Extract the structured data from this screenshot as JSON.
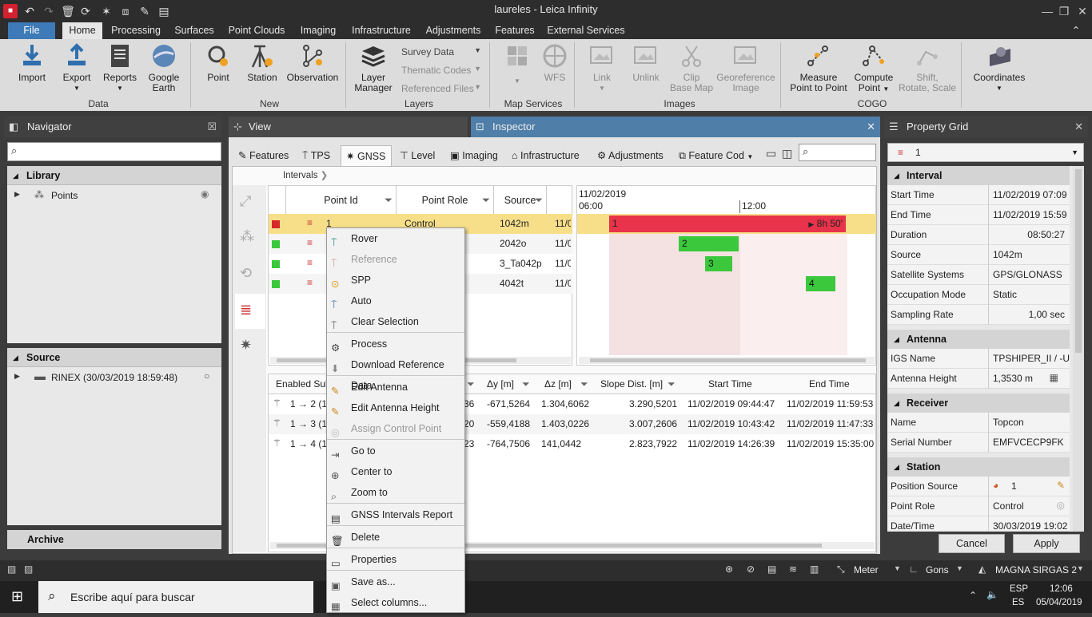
{
  "window": {
    "title": "laureles - Leica Infinity"
  },
  "menu": {
    "file": "File",
    "tabs": [
      "Home",
      "Processing",
      "Surfaces",
      "Point Clouds",
      "Imaging",
      "Infrastructure",
      "Adjustments",
      "Features",
      "External Services"
    ]
  },
  "ribbon": {
    "data": {
      "label": "Data",
      "import": "Import",
      "export": "Export",
      "reports": "Reports",
      "google_earth_1": "Google",
      "google_earth_2": "Earth"
    },
    "new": {
      "label": "New",
      "point": "Point",
      "station": "Station",
      "observation": "Observation"
    },
    "layers": {
      "label": "Layers",
      "layer_manager_1": "Layer",
      "layer_manager_2": "Manager",
      "survey_data": "Survey Data",
      "thematic_codes": "Thematic Codes",
      "referenced_files": "Referenced Files"
    },
    "map_services": {
      "label": "Map Services",
      "wfs": "WFS"
    },
    "images": {
      "label": "Images",
      "link": "Link",
      "unlink": "Unlink",
      "clip_1": "Clip",
      "clip_2": "Base Map",
      "georef_1": "Georeference",
      "georef_2": "Image"
    },
    "cogo": {
      "label": "COGO",
      "measure_1": "Measure",
      "measure_2": "Point to Point",
      "compute_1": "Compute",
      "compute_2": "Point",
      "shift_1": "Shift,",
      "shift_2": "Rotate, Scale"
    },
    "coordinates": {
      "label": "Coordinates"
    }
  },
  "navigator": {
    "title": "Navigator",
    "library": "Library",
    "points": "Points",
    "source": "Source",
    "rinex": "RINEX (30/03/2019 18:59:48)",
    "archive": "Archive"
  },
  "view": {
    "title": "View"
  },
  "inspector": {
    "title": "Inspector",
    "tabs": [
      "Features",
      "TPS",
      "GNSS",
      "Level",
      "Imaging",
      "Infrastructure",
      "Adjustments",
      "Feature Cod"
    ],
    "breadcrumb": "Intervals",
    "columns": [
      "Point Id",
      "Point Role",
      "Source"
    ],
    "rows": [
      {
        "id": "1",
        "role": "Control",
        "source": "1042m",
        "date": "11/0"
      },
      {
        "id": "2",
        "role": "",
        "source": "2042o",
        "date": "11/0"
      },
      {
        "id": "3",
        "role": "",
        "source": "3_Ta042p",
        "date": "11/0"
      },
      {
        "id": "4",
        "role": "",
        "source": "4042t",
        "date": "11/0"
      }
    ],
    "timeline": {
      "date": "11/02/2019",
      "t1": "06:00",
      "t2": "12:00",
      "bar1_label": "1",
      "bar1_duration": "8h 50'",
      "bar2": "2",
      "bar3": "3",
      "bar4": "4"
    },
    "baseline_columns": [
      "Enabled Sub",
      "Δy [m]",
      "Δz [m]",
      "Slope Dist. [m]",
      "Start Time",
      "End Time"
    ],
    "baselines": [
      {
        "name": "1 → 2 (1",
        "dx_tail": "36",
        "dy": "-671,5264",
        "dz": "1.304,6062",
        "slope": "3.290,5201",
        "start": "11/02/2019 09:44:47",
        "end": "11/02/2019 11:59:53"
      },
      {
        "name": "1 → 3 (1",
        "dx_tail": "20",
        "dy": "-559,4188",
        "dz": "1.403,0226",
        "slope": "3.007,2606",
        "start": "11/02/2019 10:43:42",
        "end": "11/02/2019 11:47:33"
      },
      {
        "name": "1 → 4 (1",
        "dx_tail": "23",
        "dy": "-764,7506",
        "dz": "141,0442",
        "slope": "2.823,7922",
        "start": "11/02/2019 14:26:39",
        "end": "11/02/2019 15:35:00"
      }
    ]
  },
  "context_menu": {
    "items": [
      "Rover",
      "Reference",
      "SPP",
      "Auto",
      "Clear Selection",
      "Process",
      "Download Reference Data",
      "Edit Antenna",
      "Edit Antenna Height",
      "Assign Control Point",
      "Go to",
      "Center to",
      "Zoom to",
      "GNSS Intervals Report",
      "Delete",
      "Properties",
      "Save as...",
      "Select columns..."
    ]
  },
  "property_grid": {
    "title": "Property Grid",
    "selector": "1",
    "interval": {
      "label": "Interval",
      "start_k": "Start Time",
      "start_v": "11/02/2019 07:09",
      "end_k": "End Time",
      "end_v": "11/02/2019 15:59",
      "dur_k": "Duration",
      "dur_v": "08:50:27",
      "src_k": "Source",
      "src_v": "1042m",
      "sat_k": "Satellite Systems",
      "sat_v": "GPS/GLONASS",
      "occ_k": "Occupation Mode",
      "occ_v": "Static",
      "rate_k": "Sampling Rate",
      "rate_v": "1,00 sec"
    },
    "antenna": {
      "label": "Antenna",
      "igs_k": "IGS Name",
      "igs_v": "TPSHIPER_II / -U",
      "h_k": "Antenna Height",
      "h_v": "1,3530  m"
    },
    "receiver": {
      "label": "Receiver",
      "name_k": "Name",
      "name_v": "Topcon",
      "sn_k": "Serial Number",
      "sn_v": "EMFVCECP9FK"
    },
    "station": {
      "label": "Station",
      "pos_k": "Position Source",
      "pos_v": "1",
      "role_k": "Point Role",
      "role_v": "Control",
      "date_k": "Date/Time",
      "date_v": "30/03/2019 19:02"
    },
    "cancel": "Cancel",
    "apply": "Apply"
  },
  "statusbar": {
    "units": "Meter",
    "angle": "Gons",
    "crs": "MAGNA SIRGAS 2"
  },
  "taskbar": {
    "search": "Escribe aquí para buscar",
    "lang1": "ESP",
    "lang2": "ES",
    "time": "12:06",
    "date": "05/04/2019"
  },
  "colors": {
    "accent": "#3d7ab7",
    "selected_row": "#f7df8a",
    "bar_red": "#e8334a",
    "bar_green": "#3cc83c"
  }
}
